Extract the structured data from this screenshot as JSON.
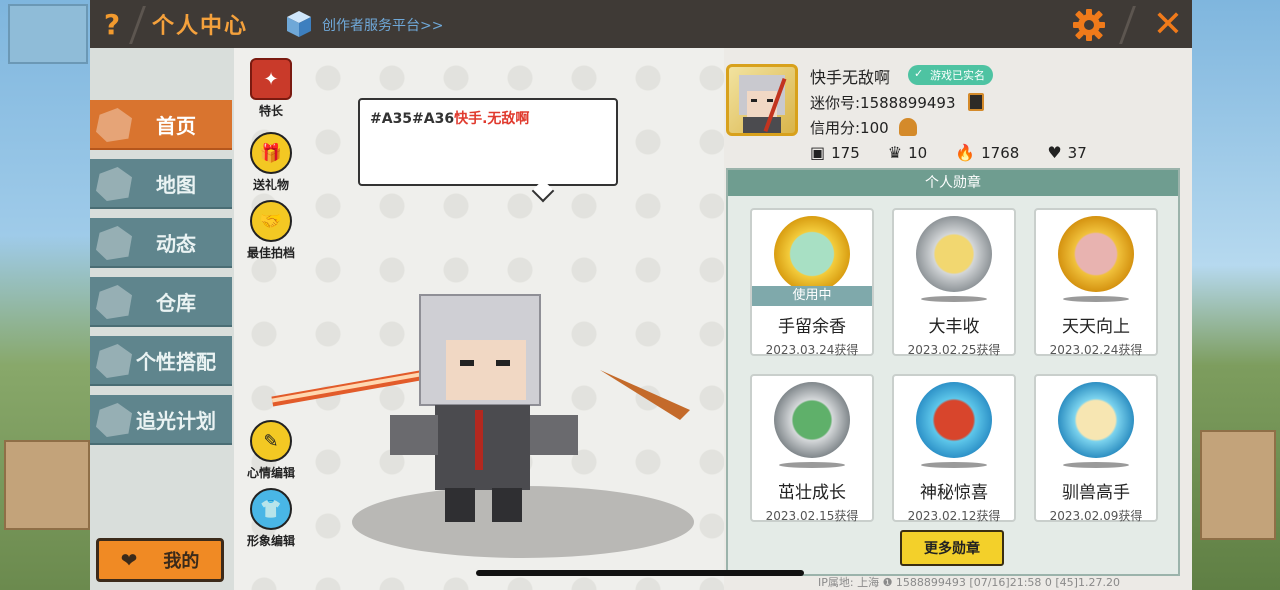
{
  "titlebar": {
    "help": "?",
    "title": "个人中心",
    "platform_link": "创作者服务平台>>",
    "close": "✕"
  },
  "sidebar": {
    "items": [
      {
        "label": "首页",
        "active": true
      },
      {
        "label": "地图",
        "active": false
      },
      {
        "label": "动态",
        "active": false
      },
      {
        "label": "仓库",
        "active": false
      },
      {
        "label": "个性搭配",
        "active": false
      },
      {
        "label": "追光计划",
        "active": false
      }
    ],
    "my_button": "我的"
  },
  "stage": {
    "tools": [
      "特长",
      "送礼物",
      "最佳拍档",
      "心情编辑",
      "形象编辑"
    ],
    "speech_prefix": "#A35#A36",
    "speech_name": "快手.无敌啊"
  },
  "profile": {
    "name": "快手无敌啊",
    "verified": "游戏已实名",
    "mini_id": "迷你号:1588899493",
    "credit": "信用分:100",
    "stats": {
      "posts": "175",
      "fans": "10",
      "heat": "1768",
      "likes": "37"
    }
  },
  "badges": {
    "title": "个人勋章",
    "in_use_label": "使用中",
    "items": [
      {
        "name": "手留余香",
        "date": "2023.03.24获得",
        "style": "gold",
        "in_use": true
      },
      {
        "name": "大丰收",
        "date": "2023.02.25获得",
        "style": "silver",
        "in_use": false
      },
      {
        "name": "天天向上",
        "date": "2023.02.24获得",
        "style": "gold2",
        "in_use": false
      },
      {
        "name": "茁壮成长",
        "date": "2023.02.15获得",
        "style": "silver2",
        "in_use": false
      },
      {
        "name": "神秘惊喜",
        "date": "2023.02.12获得",
        "style": "blue",
        "in_use": false
      },
      {
        "name": "驯兽高手",
        "date": "2023.02.09获得",
        "style": "blue2",
        "in_use": false
      }
    ],
    "more_button": "更多勋章"
  },
  "footer": "IP属地: 上海 ❶    1588899493    [07/16]21:58 0  [45]1.27.20",
  "colors": {
    "accent_orange": "#f29a2e",
    "sidebar_teal": "#5f858d",
    "active_orange": "#d9742f",
    "badge_header": "#6f9d90"
  }
}
